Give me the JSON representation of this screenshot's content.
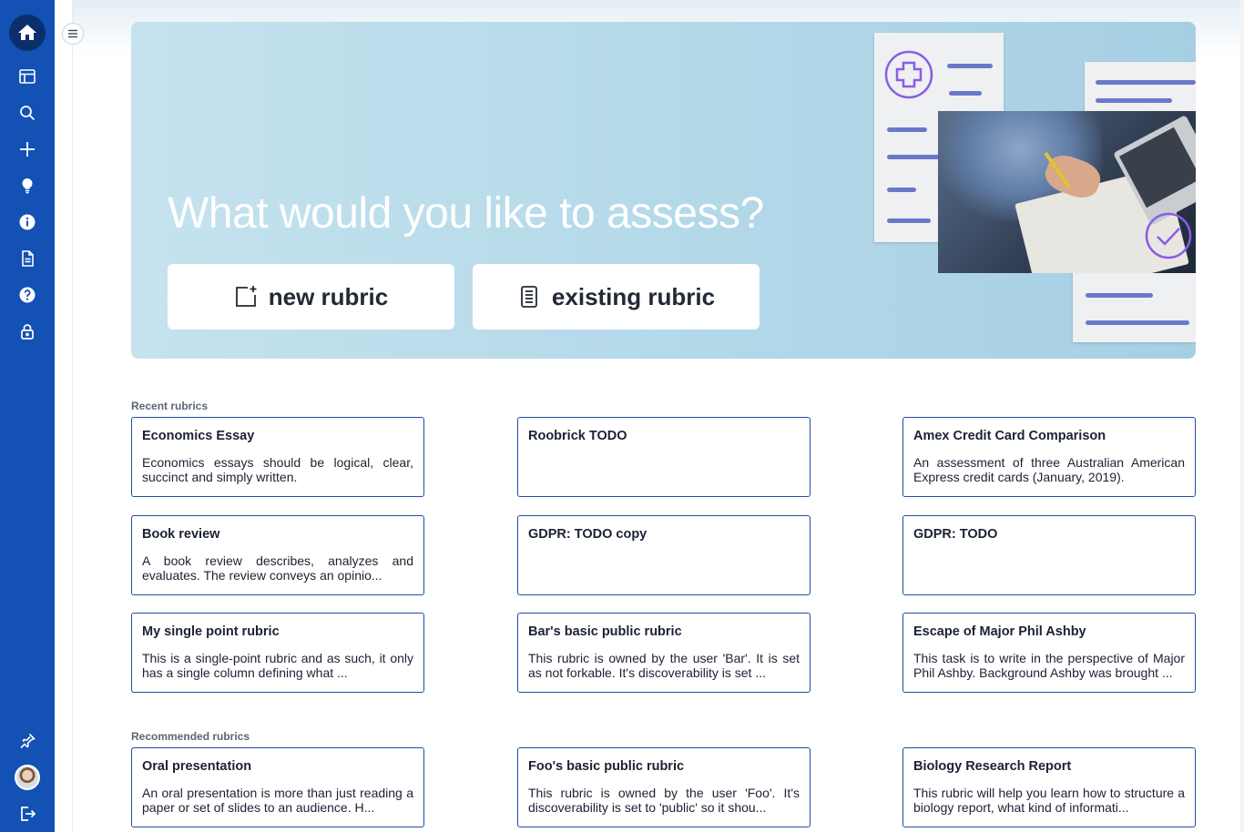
{
  "sidebar": {
    "items": [
      {
        "icon": "home-icon",
        "label": "Home"
      },
      {
        "icon": "layout-icon",
        "label": "Dashboard"
      },
      {
        "icon": "search-icon",
        "label": "Search"
      },
      {
        "icon": "plus-icon",
        "label": "Create"
      },
      {
        "icon": "lightbulb-icon",
        "label": "Ideas"
      },
      {
        "icon": "info-icon",
        "label": "Info"
      },
      {
        "icon": "document-icon",
        "label": "Documents"
      },
      {
        "icon": "help-icon",
        "label": "Help"
      },
      {
        "icon": "lock-icon",
        "label": "Privacy"
      }
    ],
    "bottom": [
      {
        "icon": "pin-icon",
        "label": "Pin"
      },
      {
        "icon": "avatar",
        "label": "Profile"
      },
      {
        "icon": "logout-icon",
        "label": "Log out"
      }
    ],
    "color": "#1351b4"
  },
  "hero": {
    "title": "What would you like to assess?",
    "new_rubric_label": "new rubric",
    "existing_rubric_label": "existing rubric"
  },
  "recent": {
    "label": "Recent rubrics",
    "cards": [
      {
        "title": "Economics Essay",
        "desc": "Economics essays should be logical, clear, succinct and simply written."
      },
      {
        "title": "Roobrick TODO",
        "desc": ""
      },
      {
        "title": "Amex Credit Card Comparison",
        "desc": "An assessment of three Australian American Express credit cards (January, 2019)."
      },
      {
        "title": "Book review",
        "desc": "A book review describes, analyzes and evaluates. The review conveys an opinio..."
      },
      {
        "title": "GDPR: TODO copy",
        "desc": ""
      },
      {
        "title": "GDPR: TODO",
        "desc": ""
      },
      {
        "title": "My single point rubric",
        "desc": "This is a single-point rubric and as such, it only has a single column defining what ..."
      },
      {
        "title": "Bar's basic public rubric",
        "desc": "This rubric is owned by the user 'Bar'. It is set as not forkable. It's discoverability is set ..."
      },
      {
        "title": "Escape of Major Phil Ashby",
        "desc": "This task is to write in the perspective of Major Phil Ashby. Background Ashby was brought ..."
      }
    ]
  },
  "recommended": {
    "label": "Recommended rubrics",
    "cards": [
      {
        "title": "Oral presentation",
        "desc": "An oral presentation is more than just reading a paper or set of slides to an audience. H..."
      },
      {
        "title": "Foo's basic public rubric",
        "desc": "This rubric is owned by the user 'Foo'. It's discoverability is set to 'public' so it shou..."
      },
      {
        "title": "Biology Research Report",
        "desc": "This rubric will help you learn how to structure a biology report, what kind of informati..."
      }
    ]
  }
}
